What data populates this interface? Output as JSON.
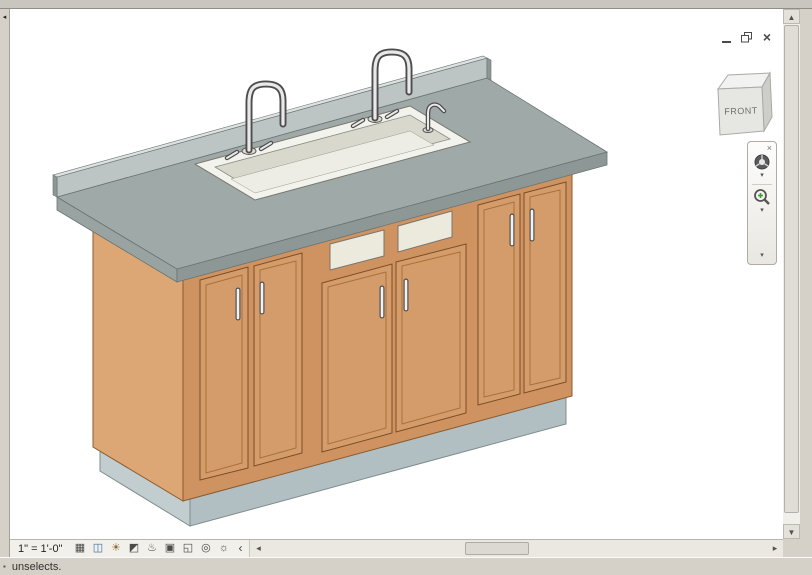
{
  "window_controls": {
    "close_glyph": "×"
  },
  "viewcube": {
    "front_label": "FRONT"
  },
  "navigation_bar": {
    "close_glyph": "×",
    "wheel_chevron": "▾",
    "zoom_chevron": "▾",
    "expand_chevron": "▾"
  },
  "view_control_bar": {
    "scale": "1\" = 1'-0\"",
    "collapse_arrow": "‹",
    "icons": [
      {
        "name": "detail-level",
        "glyph": "▦"
      },
      {
        "name": "visual-style",
        "glyph": "◫"
      },
      {
        "name": "sun-path",
        "glyph": "☀"
      },
      {
        "name": "shadows",
        "glyph": "◩"
      },
      {
        "name": "show-rendering",
        "glyph": "♨"
      },
      {
        "name": "crop-view",
        "glyph": "▣"
      },
      {
        "name": "show-crop-region",
        "glyph": "◱"
      },
      {
        "name": "temporary-hide-isolate",
        "glyph": "◎"
      },
      {
        "name": "reveal-hidden",
        "glyph": "☼"
      }
    ]
  },
  "scrollbar": {
    "up": "▲",
    "down": "▼",
    "left": "◂",
    "right": "▸",
    "panel_arrow": "◂"
  },
  "status_bar": {
    "grip": "▪",
    "text": "unselects."
  },
  "scene": {
    "colors": {
      "counter-top": "#9fa9a8",
      "counter-edge": "#8d9896",
      "counter-edge-side": "#99a3a1",
      "backsplash": "#bcc5c4",
      "backsplash-top": "#dde2e1",
      "cabinet-front": "#cf9261",
      "cabinet-side": "#dda775",
      "door": "#d59c6b",
      "door-edge": "#7c4e24",
      "door-panel": "#a87039",
      "drawer": "#ece9dd",
      "plinth-front": "#b2bfc2",
      "plinth-side": "#c2cdcf",
      "sink-rim": "#f3f3ee",
      "sink-wall": "#d8d8cd",
      "sink-floor": "#edede5",
      "faucet-dark": "#4e4e4e",
      "faucet-light": "#e9e9e9",
      "accent-green": "#3f9c35"
    }
  }
}
